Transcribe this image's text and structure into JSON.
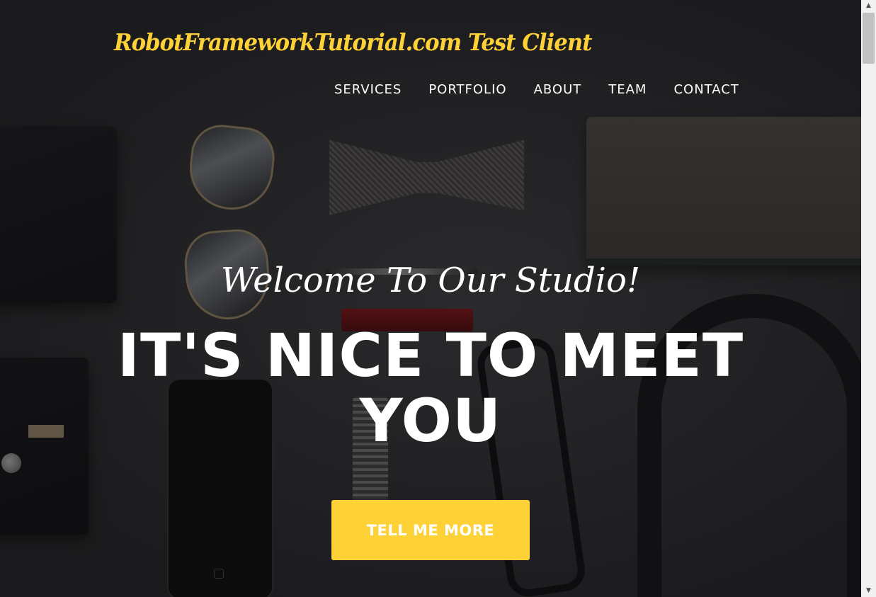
{
  "brand": {
    "name": "RobotFrameworkTutorial.com Test Client"
  },
  "nav": {
    "items": [
      {
        "label": "SERVICES"
      },
      {
        "label": "PORTFOLIO"
      },
      {
        "label": "ABOUT"
      },
      {
        "label": "TEAM"
      },
      {
        "label": "CONTACT"
      }
    ]
  },
  "hero": {
    "lead": "Welcome To Our Studio!",
    "heading_line1": "IT'S NICE TO MEET",
    "heading_line2": "YOU",
    "cta_label": "TELL ME MORE"
  },
  "colors": {
    "accent": "#fed136",
    "text": "#ffffff"
  },
  "scrollbar": {
    "up_icon": "▲",
    "down_icon": "▼"
  }
}
